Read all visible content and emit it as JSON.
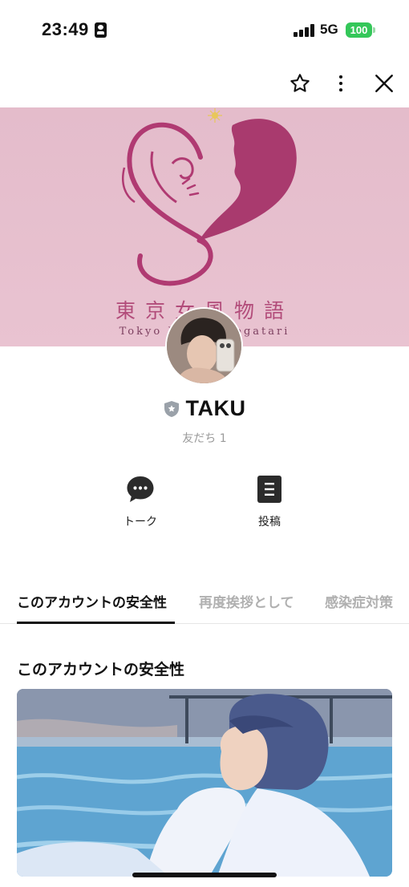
{
  "status_bar": {
    "time": "23:49",
    "network": "5G",
    "battery": "100",
    "battery_color": "#34c759"
  },
  "header": {
    "icons": [
      "star-icon",
      "more-vertical-icon",
      "close-icon"
    ]
  },
  "cover": {
    "title": "東京女風物語",
    "subtitle": "Tokyo Jofu Monogatari",
    "background_color": "#e7c0cf",
    "accent_color": "#b24c7a"
  },
  "profile": {
    "name": "TAKU",
    "friends": "友だち 1",
    "badge_icon": "shield-star-icon"
  },
  "actions": [
    {
      "label": "トーク",
      "icon": "chat-bubble-icon"
    },
    {
      "label": "投稿",
      "icon": "post-icon"
    }
  ],
  "tabs": [
    {
      "label": "このアカウントの安全性",
      "active": true
    },
    {
      "label": "再度挨拶として",
      "active": false
    },
    {
      "label": "感染症対策",
      "active": false
    }
  ],
  "section": {
    "title": "このアカウントの安全性"
  }
}
